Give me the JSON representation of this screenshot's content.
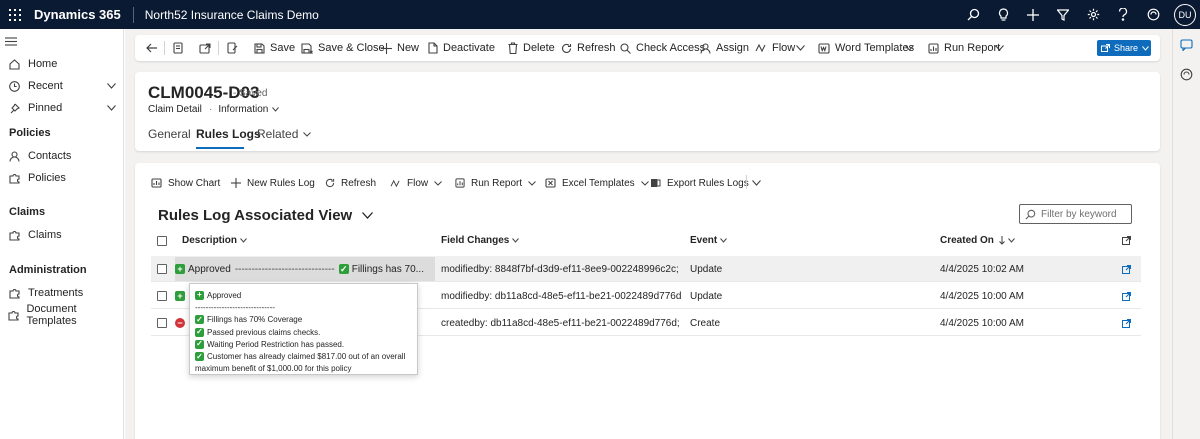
{
  "topbar": {
    "app_name": "Dynamics 365",
    "environment": "North52 Insurance Claims Demo",
    "avatar_initials": "DU",
    "icons": [
      "search-icon",
      "lightbulb-icon",
      "plus-icon",
      "filter-icon",
      "gear-icon",
      "help-icon",
      "copilot-icon"
    ]
  },
  "nav": {
    "home": "Home",
    "recent": "Recent",
    "pinned": "Pinned",
    "section_policies": "Policies",
    "contacts": "Contacts",
    "policies": "Policies",
    "section_claims": "Claims",
    "claims": "Claims",
    "section_admin": "Administration",
    "treatments": "Treatments",
    "document_templates": "Document Templates"
  },
  "commandbar": {
    "save": "Save",
    "save_close": "Save & Close",
    "new": "New",
    "deactivate": "Deactivate",
    "delete": "Delete",
    "refresh": "Refresh",
    "check_access": "Check Access",
    "assign": "Assign",
    "flow": "Flow",
    "word_templates": "Word Templates",
    "run_report": "Run Report",
    "share": "Share"
  },
  "record": {
    "title": "CLM0045-D03",
    "status": "- Saved",
    "entity": "Claim Detail",
    "form": "Information",
    "tabs": {
      "general": "General",
      "rules_logs": "Rules Logs",
      "related": "Related"
    }
  },
  "subgrid": {
    "commands": {
      "show_chart": "Show Chart",
      "new_rules_log": "New Rules Log",
      "refresh": "Refresh",
      "flow": "Flow",
      "run_report": "Run Report",
      "excel_templates": "Excel Templates",
      "export": "Export Rules Logs"
    },
    "view_title": "Rules Log Associated View",
    "filter_placeholder": "Filter by keyword",
    "columns": {
      "description": "Description",
      "field_changes": "Field Changes",
      "event": "Event",
      "created_on": "Created On"
    },
    "rows": [
      {
        "icon": "plus",
        "desc_main": "Approved",
        "desc_rest": "------------------------------",
        "desc_tail": "Fillings has 70...",
        "field_changes": "modifiedby: 8848f7bf-d3d9-ef11-8ee9-002248996c2c; ;  m...",
        "event": "Update",
        "created_on": "4/4/2025 10:02 AM"
      },
      {
        "icon": "plus",
        "desc_main": "Approved",
        "desc_rest": "",
        "desc_tail": "",
        "field_changes": "modifiedby: db11a8cd-48e5-ef11-be21-0022489d776d; ;  ...",
        "event": "Update",
        "created_on": "4/4/2025 10:00 AM"
      },
      {
        "icon": "no",
        "desc_main": "",
        "desc_rest": "",
        "desc_tail": "",
        "field_changes": "createdby: db11a8cd-48e5-ef11-be21-0022489d776d; ;  cr...",
        "event": "Create",
        "created_on": "4/4/2025 10:00 AM"
      }
    ]
  },
  "tooltip": {
    "line1": "Approved",
    "line2": "------------------------------",
    "line3": "Fillings has 70% Coverage",
    "line4": "Passed previous claims checks.",
    "line5": "Waiting Period Restriction has passed.",
    "line6": "Customer has already claimed $817.00 out of an overall",
    "line7": "maximum benefit of $1,000.00 for this policy"
  },
  "colors": {
    "topbar": "#0b1a33",
    "accent": "#0f6cbd",
    "success": "#2e9e3a",
    "blocked": "#d13438"
  }
}
